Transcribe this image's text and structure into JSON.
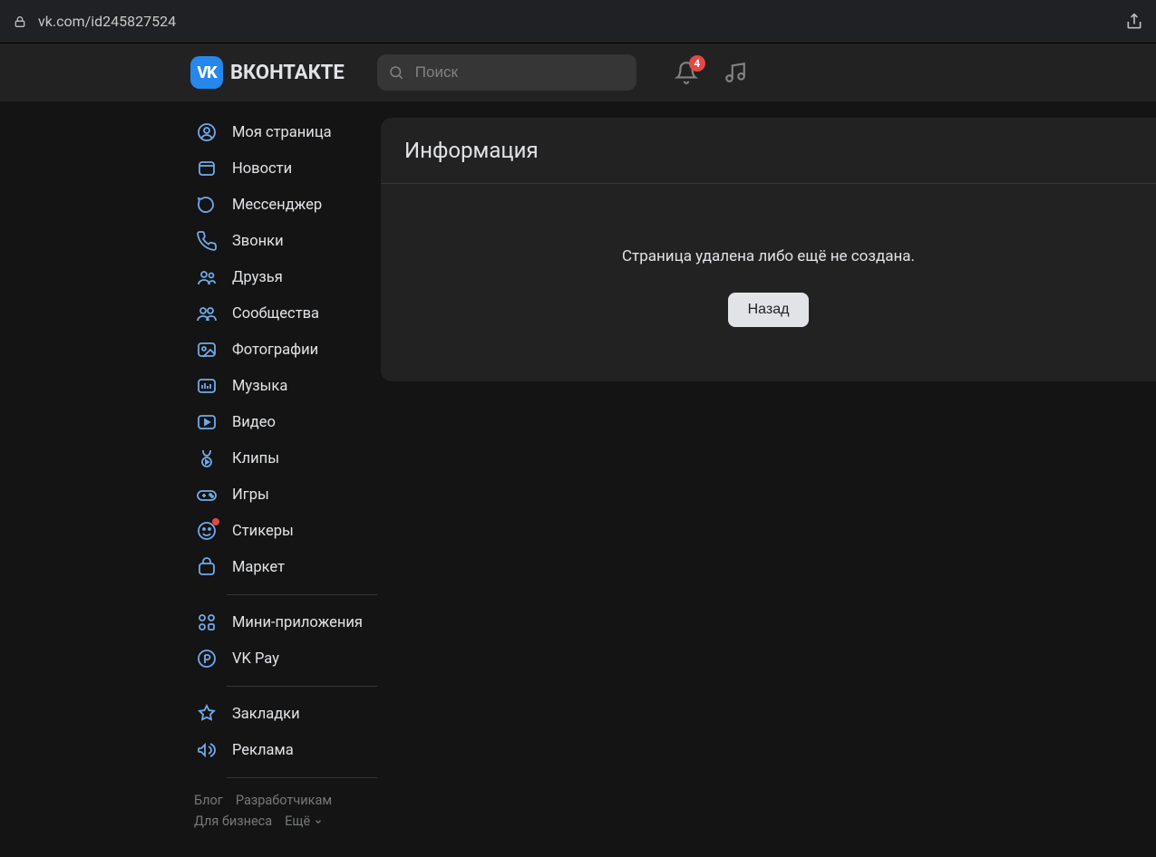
{
  "browser": {
    "url": "vk.com/id245827524"
  },
  "header": {
    "logo_text": "ВКОНТАКТЕ",
    "search_placeholder": "Поиск",
    "notification_badge": "4"
  },
  "sidebar": {
    "groups": [
      [
        {
          "icon": "profile",
          "label": "Моя страница"
        },
        {
          "icon": "news",
          "label": "Новости"
        },
        {
          "icon": "messenger",
          "label": "Мессенджер"
        },
        {
          "icon": "calls",
          "label": "Звонки"
        },
        {
          "icon": "friends",
          "label": "Друзья"
        },
        {
          "icon": "communities",
          "label": "Сообщества"
        },
        {
          "icon": "photos",
          "label": "Фотографии"
        },
        {
          "icon": "music",
          "label": "Музыка"
        },
        {
          "icon": "video",
          "label": "Видео"
        },
        {
          "icon": "clips",
          "label": "Клипы"
        },
        {
          "icon": "games",
          "label": "Игры"
        },
        {
          "icon": "stickers",
          "label": "Стикеры",
          "dot": true
        },
        {
          "icon": "market",
          "label": "Маркет"
        }
      ],
      [
        {
          "icon": "apps",
          "label": "Мини-приложения"
        },
        {
          "icon": "pay",
          "label": "VK Pay"
        }
      ],
      [
        {
          "icon": "bookmarks",
          "label": "Закладки"
        },
        {
          "icon": "ads",
          "label": "Реклама"
        }
      ]
    ],
    "footer": [
      "Блог",
      "Разработчикам",
      "Для бизнеса",
      "Ещё"
    ]
  },
  "content": {
    "title": "Информация",
    "message": "Страница удалена либо ещё не создана.",
    "back_label": "Назад"
  }
}
